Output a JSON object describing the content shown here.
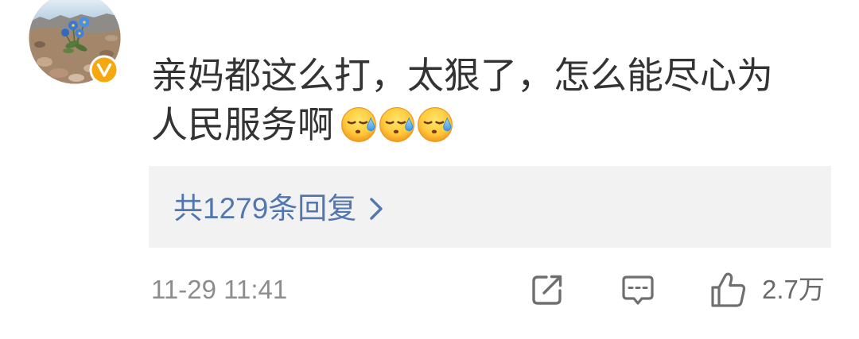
{
  "user": {
    "verified_badge_icon": "yellow-v-verified-icon"
  },
  "comment": {
    "lines": [
      "亲妈都这么打，太狠了，怎么能尽心为",
      "人民服务啊"
    ],
    "emojis": [
      "cold-sweat-face-emoji",
      "cold-sweat-face-emoji",
      "cold-sweat-face-emoji"
    ]
  },
  "replies": {
    "label": "共1279条回复",
    "chevron_icon": "chevron-right-icon"
  },
  "footer": {
    "timestamp": "11-29 11:41",
    "share_icon": "share-icon",
    "comment_icon": "comment-icon",
    "like_icon": "thumbs-up-icon",
    "like_count": "2.7万"
  },
  "colors": {
    "background": "#ffffff",
    "body_text": "#333333",
    "link": "#5276b0",
    "meta_text": "#8d8d8d",
    "reply_box": "#f2f2f2",
    "icon": "#6f6f6f",
    "like_count": "#6a6a6a",
    "verified_badge": "#f6a90f"
  }
}
